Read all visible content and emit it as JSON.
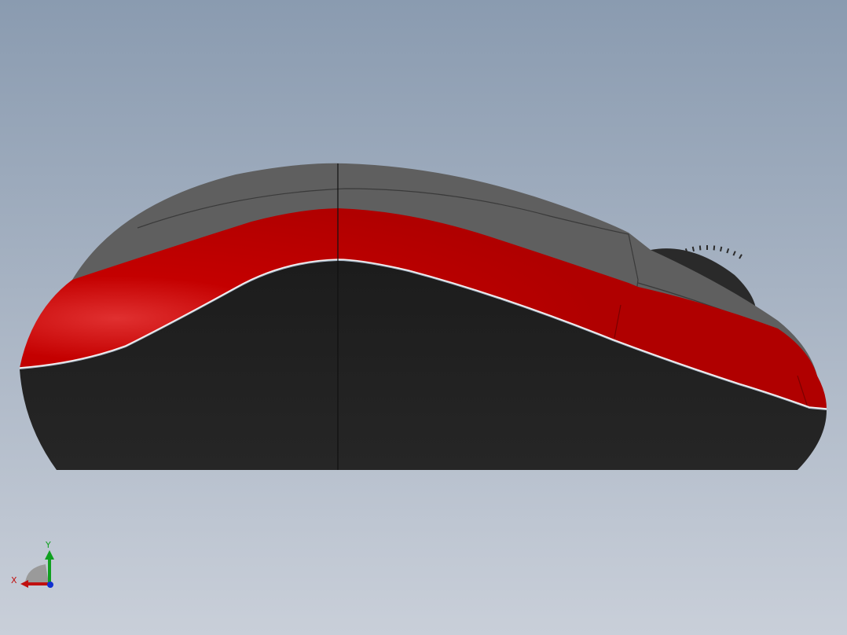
{
  "viewport": {
    "background_top": "#8a9bb0",
    "background_bottom": "#c9cfd9"
  },
  "model": {
    "colors": {
      "shell_gray": "#5f5f5f",
      "grip_red": "#c00000",
      "base_black": "#222222",
      "wheel_black": "#2a2a2a"
    }
  },
  "triad": {
    "x_label": "X",
    "y_label": "Y",
    "x_color": "#c01010",
    "y_color": "#10a020",
    "z_color": "#1030d0"
  }
}
